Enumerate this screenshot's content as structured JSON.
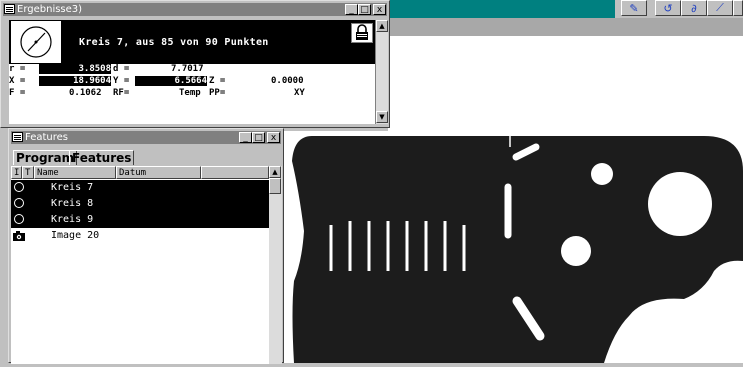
{
  "results": {
    "title": "Ergebnisse3)",
    "headline": "Kreis 7, aus 85 von 90 Punkten",
    "r_label": "r =",
    "r_value": "3.8508",
    "d_label": "d =",
    "d_value": "7.7017",
    "x_label": "X =",
    "x_value": "18.9604",
    "y_label": "Y =",
    "y_value": "6.5664",
    "z_label": "Z =",
    "z_value": "0.0000",
    "f_label": "F =",
    "f_value": "0.1062",
    "rf_label": "RF=",
    "temp_label": "Temp",
    "pp_label": "PP=",
    "plane": "XY"
  },
  "features": {
    "title": "Features",
    "tabs": [
      "Program",
      "Features"
    ],
    "columns": [
      "I",
      "T",
      "Name",
      "Datum"
    ],
    "rows": [
      {
        "name": "Kreis 7",
        "icon": "circle-icon",
        "selected": true
      },
      {
        "name": "Kreis 8",
        "icon": "circle-icon",
        "selected": true
      },
      {
        "name": "Kreis 9",
        "icon": "circle-icon",
        "selected": true
      },
      {
        "name": "Image 20",
        "icon": "camera-icon",
        "selected": false
      }
    ]
  },
  "window_buttons": [
    "_",
    "□",
    "x"
  ],
  "toolbar_icons": [
    "pen-icon",
    "circle-tool-icon",
    "curve-tool-icon",
    "line-tool-icon"
  ]
}
